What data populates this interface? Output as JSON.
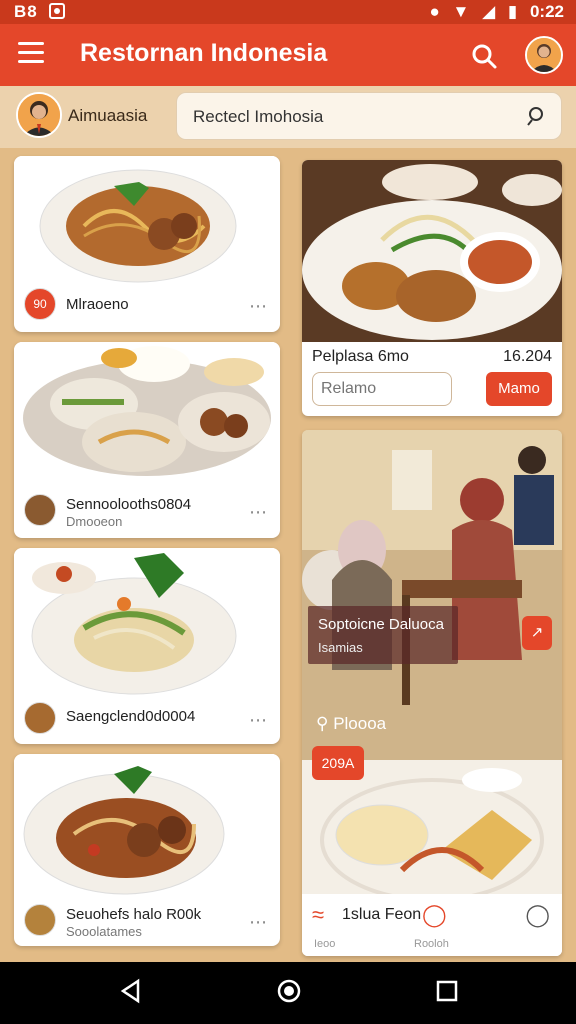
{
  "status_bar": {
    "left_text": "B8",
    "time": "0:22"
  },
  "app_bar": {
    "title": "Restornan Indonesia"
  },
  "user": {
    "name": "Aimuaasia"
  },
  "search": {
    "value": "Rectecl Imohosia"
  },
  "left_cards": [
    {
      "title": "Mlraoeno",
      "subtitle": "",
      "badge_text": "90"
    },
    {
      "title": "Sennoolooths0804",
      "subtitle": "Dmooeon"
    },
    {
      "title": "Saengclend0d0004",
      "subtitle": ""
    },
    {
      "title": "Seuohefs halo R00k",
      "subtitle": "Sooolatames"
    }
  ],
  "right_card_top": {
    "name": "Pelplasa 6mo",
    "price": "16.204",
    "field_placeholder": "Relamo",
    "button": "Mamo"
  },
  "right_card_photo": {
    "title": "Soptoicne Daluoca",
    "subtitle": "Isamias",
    "label": "Ploooa",
    "badge": "209A"
  },
  "bottom_bar": {
    "title": "1slua Feon",
    "left_caption": "Ieoo",
    "mid_caption": "Rooloh"
  },
  "colors": {
    "primary": "#e4472a",
    "status": "#c9391c",
    "background": "#e2bb86"
  }
}
